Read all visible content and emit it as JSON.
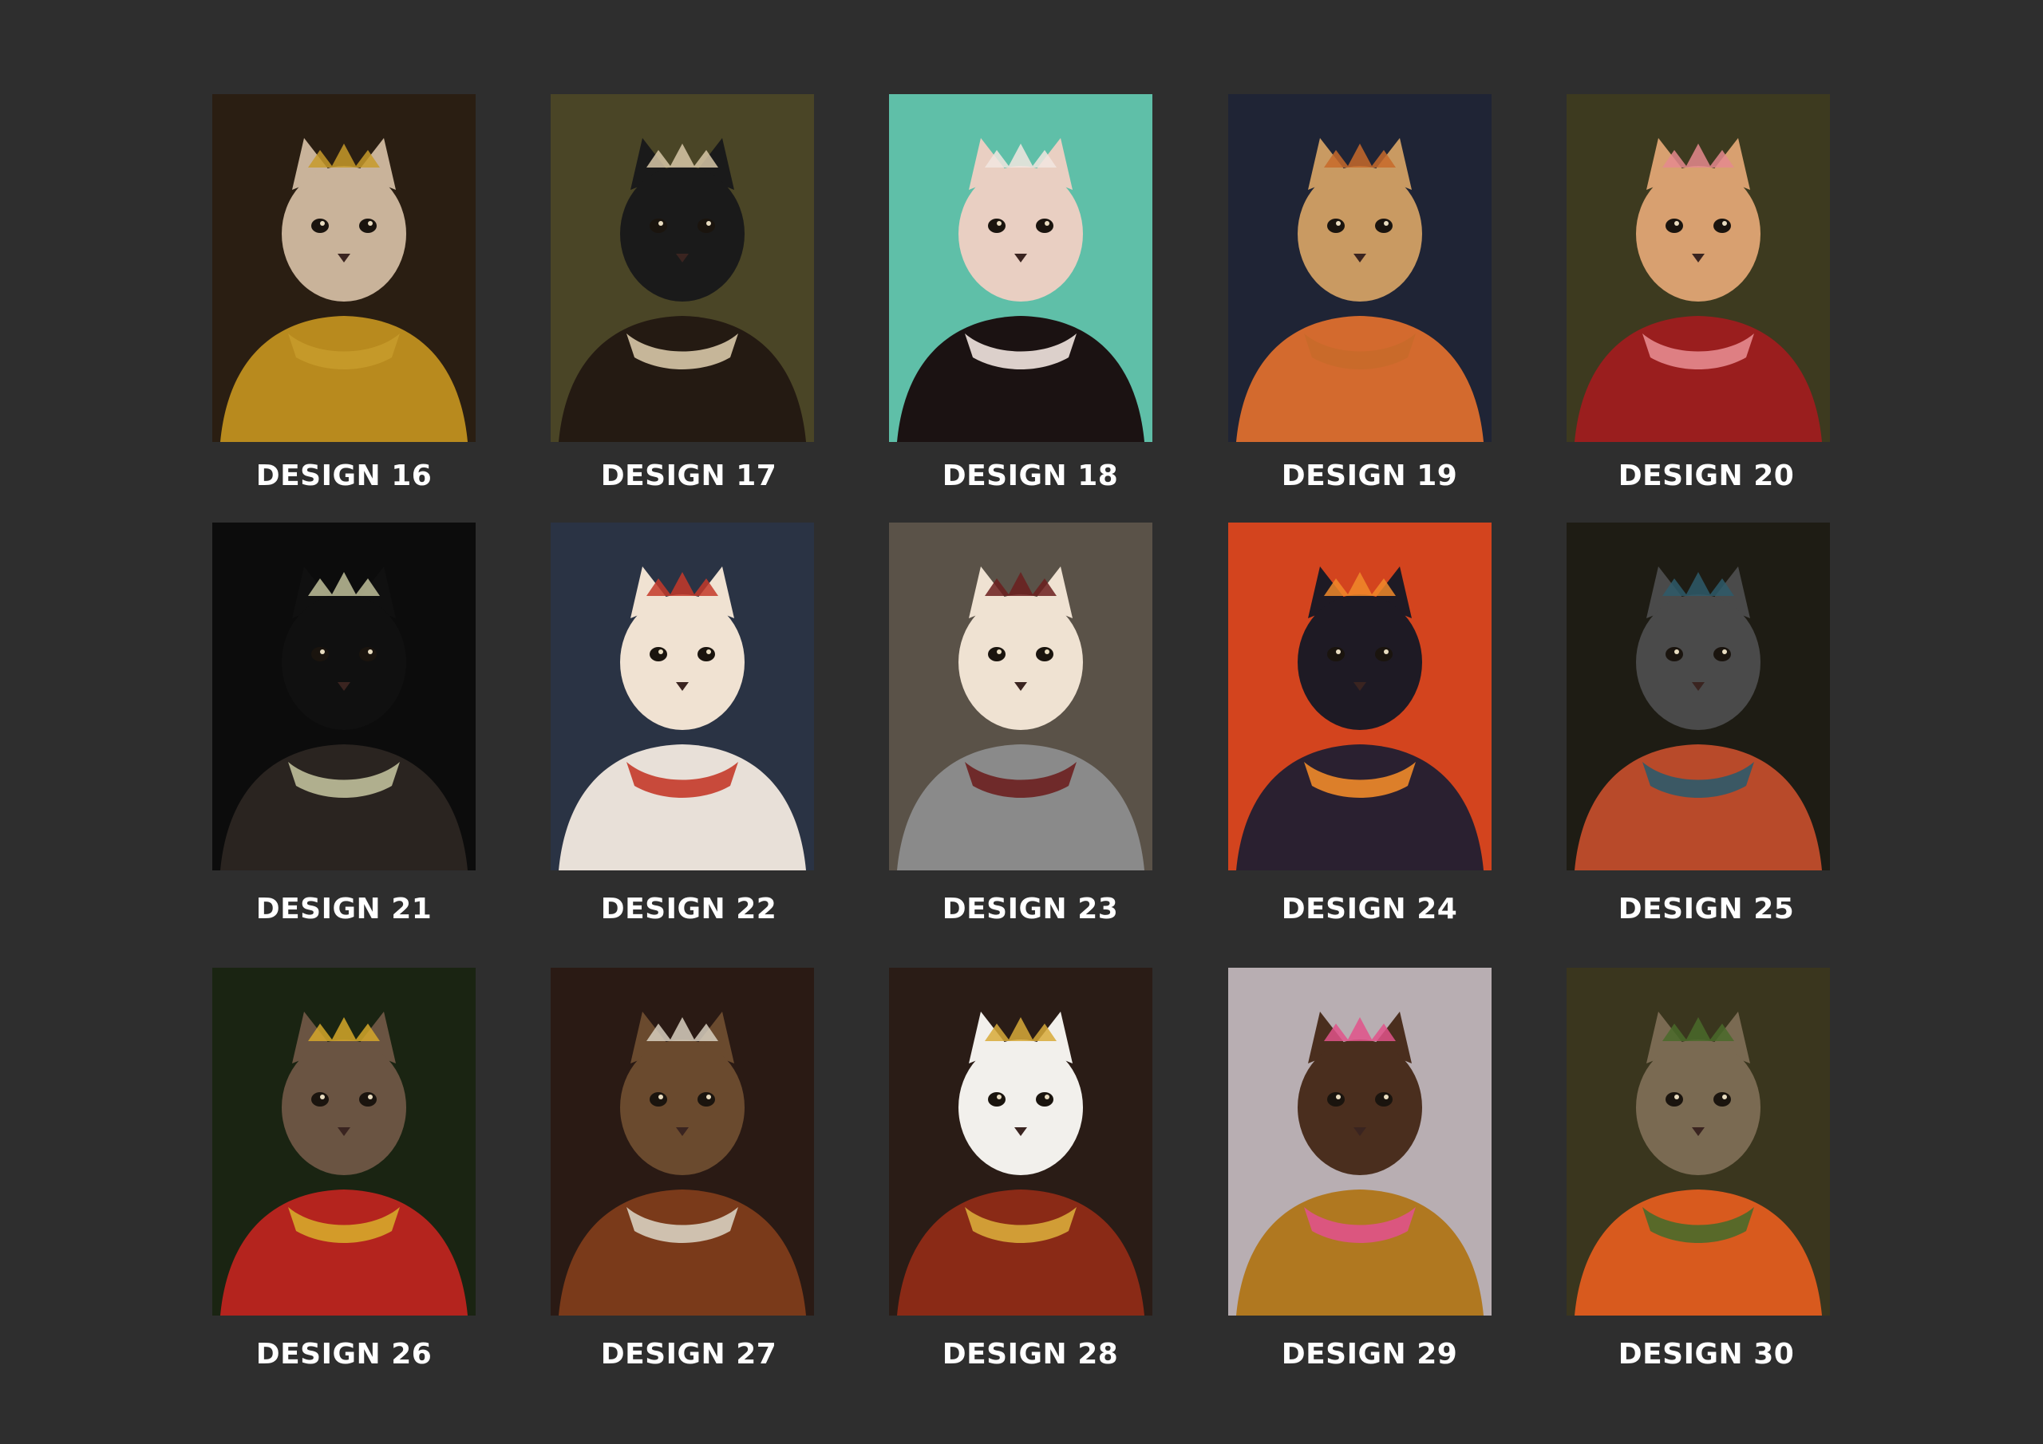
{
  "colors": {
    "background": "#2e2e2e",
    "caption": "#ffffff"
  },
  "designs": [
    {
      "label": "DESIGN 16",
      "icon": "cat-king-portrait-icon",
      "bg": "#2a1e12",
      "accent": "#c79a2a",
      "fur": "#c9b39a",
      "robe": "#b88a1e"
    },
    {
      "label": "DESIGN 17",
      "icon": "cat-nobleman-portrait-icon",
      "bg": "#4a4526",
      "accent": "#d8c8a8",
      "fur": "#1a1a1a",
      "robe": "#241a12"
    },
    {
      "label": "DESIGN 18",
      "icon": "cat-sunglasses-portrait-icon",
      "bg": "#5fbfa8",
      "accent": "#f2e6e0",
      "fur": "#e9cfc2",
      "robe": "#1b1212"
    },
    {
      "label": "DESIGN 19",
      "icon": "cat-general-portrait-icon",
      "bg": "#1f2435",
      "accent": "#c86a2a",
      "fur": "#c99a62",
      "robe": "#d36a2e"
    },
    {
      "label": "DESIGN 20",
      "icon": "dog-red-dress-portrait-icon",
      "bg": "#3d3a1f",
      "accent": "#e58a8e",
      "fur": "#d8a070",
      "robe": "#9a1e1e"
    },
    {
      "label": "DESIGN 21",
      "icon": "dog-queen-portrait-icon",
      "bg": "#0c0c0c",
      "accent": "#bfbf9a",
      "fur": "#101010",
      "robe": "#2a2420"
    },
    {
      "label": "DESIGN 22",
      "icon": "cat-emperor-portrait-icon",
      "bg": "#2a3344",
      "accent": "#c43a2a",
      "fur": "#f0e2d2",
      "robe": "#e8e0d8"
    },
    {
      "label": "DESIGN 23",
      "icon": "cat-knight-portrait-icon",
      "bg": "#5a5248",
      "accent": "#6b1f1f",
      "fur": "#efe2d2",
      "robe": "#8a8a8a"
    },
    {
      "label": "DESIGN 24",
      "icon": "cat-scream-portrait-icon",
      "bg": "#d3441e",
      "accent": "#f08a2a",
      "fur": "#1e1a24",
      "robe": "#2a2030"
    },
    {
      "label": "DESIGN 25",
      "icon": "cat-pharaoh-portrait-icon",
      "bg": "#1e1c14",
      "accent": "#2e5a6a",
      "fur": "#4a4a4a",
      "robe": "#b84a2a"
    },
    {
      "label": "DESIGN 26",
      "icon": "dog-king-crown-portrait-icon",
      "bg": "#1a2412",
      "accent": "#d6a82a",
      "fur": "#6a5442",
      "robe": "#b4241e"
    },
    {
      "label": "DESIGN 27",
      "icon": "capybara-queen-portrait-icon",
      "bg": "#2a1a14",
      "accent": "#d8d0c0",
      "fur": "#6a4a2e",
      "robe": "#7a3a1a"
    },
    {
      "label": "DESIGN 28",
      "icon": "dog-ermine-king-portrait-icon",
      "bg": "#2a1c16",
      "accent": "#d8aa3a",
      "fur": "#f2f0ec",
      "robe": "#8a2a16"
    },
    {
      "label": "DESIGN 29",
      "icon": "dog-flower-crown-portrait-icon",
      "bg": "#b8aeb2",
      "accent": "#e0528a",
      "fur": "#4a2e1e",
      "robe": "#b07820"
    },
    {
      "label": "DESIGN 30",
      "icon": "cat-laurel-portrait-icon",
      "bg": "#3a361e",
      "accent": "#4a6a2a",
      "fur": "#7a6a52",
      "robe": "#d85a1e"
    }
  ]
}
